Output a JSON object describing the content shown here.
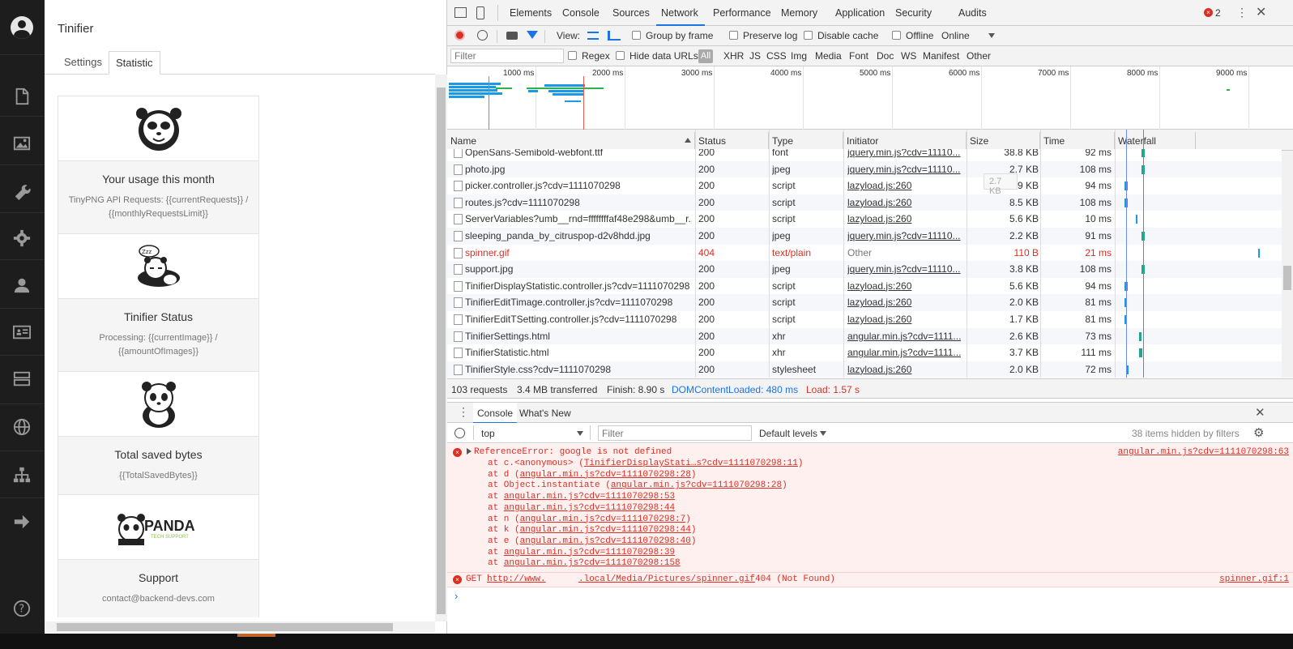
{
  "panel": {
    "title": "Tinifier",
    "tabs": [
      "Settings",
      "Statistic"
    ],
    "active_tab": "Statistic",
    "cards": [
      {
        "title": "Your usage this month",
        "text": "TinyPNG API Requests: {{currentRequests}} / {{monthlyRequestsLimit}}",
        "logo": "panda-face"
      },
      {
        "title": "Tinifier Status",
        "text": "Processing: {{currentImage}} / {{amountOfImages}}",
        "logo": "sleeping-panda"
      },
      {
        "title": "Total saved bytes",
        "text": "{{TotalSavedBytes}}",
        "logo": "sitting-panda"
      },
      {
        "title": "Support",
        "text": "contact@backend-devs.com",
        "logo": "panda-tech-support",
        "logo_text": "PANDA",
        "logo_subtext": "TECH SUPPORT"
      }
    ]
  },
  "rail_icons": [
    "user-avatar-icon",
    "document-icon",
    "image-icon",
    "wrench-icon",
    "gear-icon",
    "person-icon",
    "id-card-icon",
    "server-icon",
    "globe-icon",
    "sitemap-icon",
    "arrow-right-icon",
    "help-icon"
  ],
  "devtools": {
    "tabs": [
      "Elements",
      "Console",
      "Sources",
      "Network",
      "Performance",
      "Memory",
      "Application",
      "Security",
      "Audits"
    ],
    "active_tab": "Network",
    "error_count": "2",
    "toolbar": {
      "view_label": "View:",
      "group_by_frame": "Group by frame",
      "preserve_log": "Preserve log",
      "disable_cache": "Disable cache",
      "offline": "Offline",
      "throttle": "Online"
    },
    "filter": {
      "placeholder": "Filter",
      "regex": "Regex",
      "hide_data_urls": "Hide data URLs",
      "types": [
        "All",
        "XHR",
        "JS",
        "CSS",
        "Img",
        "Media",
        "Font",
        "Doc",
        "WS",
        "Manifest",
        "Other"
      ]
    },
    "timeline_ticks": [
      "1000 ms",
      "2000 ms",
      "3000 ms",
      "4000 ms",
      "5000 ms",
      "6000 ms",
      "7000 ms",
      "8000 ms",
      "9000 ms"
    ],
    "columns": [
      "Name",
      "Status",
      "Type",
      "Initiator",
      "Size",
      "Time",
      "Waterfall"
    ],
    "rows": [
      {
        "name": "OpenSans-Semibold-webfont.ttf",
        "status": "200",
        "type": "font",
        "initiator": "jquery.min.js?cdv=11110...",
        "size": "38.8 KB",
        "time": "92 ms",
        "error": false
      },
      {
        "name": "photo.jpg",
        "status": "200",
        "type": "jpeg",
        "initiator": "jquery.min.js?cdv=11110...",
        "size": "2.7 KB",
        "time": "108 ms",
        "error": false
      },
      {
        "name": "picker.controller.js?cdv=1111070298",
        "status": "200",
        "type": "script",
        "initiator": "lazyload.js:260",
        "size": "1.9 KB",
        "time": "94 ms",
        "error": false
      },
      {
        "name": "routes.js?cdv=1111070298",
        "status": "200",
        "type": "script",
        "initiator": "lazyload.js:260",
        "size": "8.5 KB",
        "time": "108 ms",
        "error": false
      },
      {
        "name": "ServerVariables?umb__rnd=ffffffffaf48e298&umb__r...",
        "status": "200",
        "type": "script",
        "initiator": "lazyload.js:260",
        "size": "5.6 KB",
        "time": "10 ms",
        "error": false
      },
      {
        "name": "sleeping_panda_by_citruspop-d2v8hdd.jpg",
        "status": "200",
        "type": "jpeg",
        "initiator": "jquery.min.js?cdv=11110...",
        "size": "2.2 KB",
        "time": "91 ms",
        "error": false
      },
      {
        "name": "spinner.gif",
        "status": "404",
        "type": "text/plain",
        "initiator": "Other",
        "size": "110 B",
        "time": "21 ms",
        "error": true
      },
      {
        "name": "support.jpg",
        "status": "200",
        "type": "jpeg",
        "initiator": "jquery.min.js?cdv=11110...",
        "size": "3.8 KB",
        "time": "108 ms",
        "error": false
      },
      {
        "name": "TinifierDisplayStatistic.controller.js?cdv=1111070298",
        "status": "200",
        "type": "script",
        "initiator": "lazyload.js:260",
        "size": "5.6 KB",
        "time": "94 ms",
        "error": false
      },
      {
        "name": "TinifierEditTimage.controller.js?cdv=1111070298",
        "status": "200",
        "type": "script",
        "initiator": "lazyload.js:260",
        "size": "2.0 KB",
        "time": "81 ms",
        "error": false
      },
      {
        "name": "TinifierEditTSetting.controller.js?cdv=1111070298",
        "status": "200",
        "type": "script",
        "initiator": "lazyload.js:260",
        "size": "1.7 KB",
        "time": "81 ms",
        "error": false
      },
      {
        "name": "TinifierSettings.html",
        "status": "200",
        "type": "xhr",
        "initiator": "angular.min.js?cdv=1111...",
        "size": "2.6 KB",
        "time": "73 ms",
        "error": false
      },
      {
        "name": "TinifierStatistic.html",
        "status": "200",
        "type": "xhr",
        "initiator": "angular.min.js?cdv=1111...",
        "size": "3.7 KB",
        "time": "111 ms",
        "error": false
      },
      {
        "name": "TinifierStyle.css?cdv=1111070298",
        "status": "200",
        "type": "stylesheet",
        "initiator": "lazyload.js:260",
        "size": "2.0 KB",
        "time": "72 ms",
        "error": false
      }
    ],
    "tooltip": "2.7 KB",
    "summary": {
      "requests": "103 requests",
      "transferred": "3.4 MB transferred",
      "finish": "Finish: 8.90 s",
      "dom": "DOMContentLoaded: 480 ms",
      "load": "Load: 1.57 s"
    },
    "drawer_tabs": [
      "Console",
      "What's New"
    ],
    "console": {
      "context": "top",
      "filter_placeholder": "Filter",
      "levels": "Default levels",
      "hidden": "38 items hidden by filters",
      "error1": {
        "message": "ReferenceError: google is not defined",
        "source": "angular.min.js?cdv=1111070298:63",
        "stack": [
          {
            "prefix": "at c.<anonymous> (",
            "link": "TinifierDisplayStati…s?cdv=1111070298:11",
            "suffix": ")"
          },
          {
            "prefix": "at d (",
            "link": "angular.min.js?cdv=1111070298:28",
            "suffix": ")"
          },
          {
            "prefix": "at Object.instantiate (",
            "link": "angular.min.js?cdv=1111070298:28",
            "suffix": ")"
          },
          {
            "prefix": "at ",
            "link": "angular.min.js?cdv=1111070298:53",
            "suffix": ""
          },
          {
            "prefix": "at ",
            "link": "angular.min.js?cdv=1111070298:44",
            "suffix": ""
          },
          {
            "prefix": "at n (",
            "link": "angular.min.js?cdv=1111070298:7",
            "suffix": ")"
          },
          {
            "prefix": "at k (",
            "link": "angular.min.js?cdv=1111070298:44",
            "suffix": ")"
          },
          {
            "prefix": "at e (",
            "link": "angular.min.js?cdv=1111070298:40",
            "suffix": ")"
          },
          {
            "prefix": "at ",
            "link": "angular.min.js?cdv=1111070298:39",
            "suffix": ""
          },
          {
            "prefix": "at ",
            "link": "angular.min.js?cdv=1111070298:158",
            "suffix": ""
          }
        ]
      },
      "error2": {
        "method": "GET",
        "url_start": "http://www.",
        "url_end": ".local/Media/Pictures/spinner.gif",
        "status": "404 (Not Found)",
        "source": "spinner.gif:1"
      }
    }
  },
  "colors": {
    "error_red": "#d93025",
    "link_blue": "#1a73e8",
    "error_bg": "#fff0f0",
    "rail_bg": "#1d1d1d"
  }
}
